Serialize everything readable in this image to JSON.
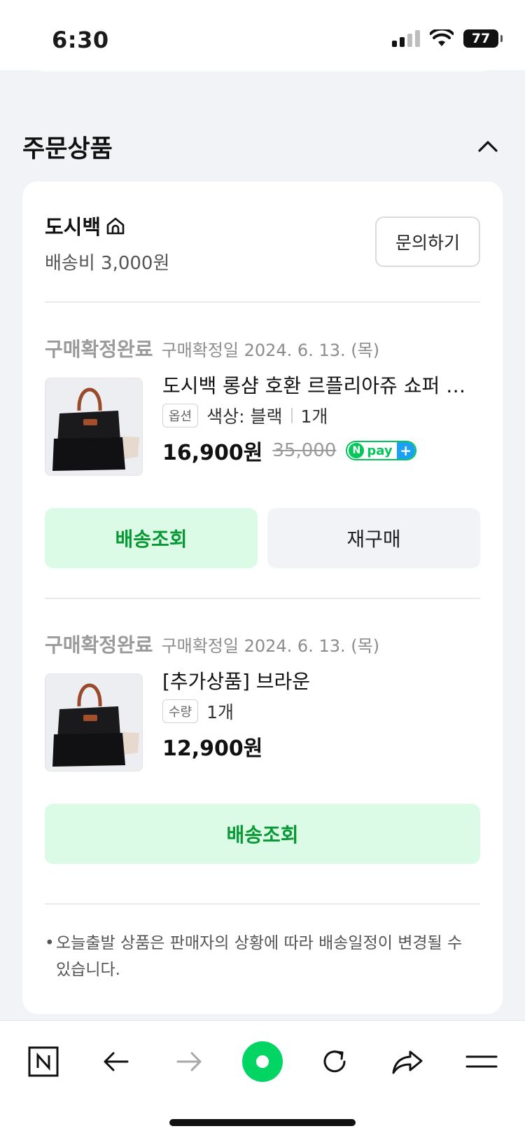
{
  "status_bar": {
    "time": "6:30",
    "battery": "77"
  },
  "section": {
    "title": "주문상품"
  },
  "seller": {
    "name": "도시백",
    "shipping_fee": "배송비 3,000원",
    "inquiry_label": "문의하기"
  },
  "orders": [
    {
      "status": "구매확정완료",
      "confirm_date": "구매확정일 2024. 6. 13. (목)",
      "item_name": "도시백 롱샴 호환 르플리아쥬 쇼퍼 백 블랙 세트",
      "option_tag": "옵션",
      "option_text": "색상: 블랙",
      "quantity": "1개",
      "price": "16,900원",
      "original_price": "35,000",
      "npay_label": "pay",
      "track_label": "배송조회",
      "rebuy_label": "재구매"
    },
    {
      "status": "구매확정완료",
      "confirm_date": "구매확정일 2024. 6. 13. (목)",
      "item_name": "[추가상품] 브라운",
      "option_tag": "수량",
      "quantity": "1개",
      "price": "12,900원",
      "track_label": "배송조회"
    }
  ],
  "notice": {
    "bullet": "•",
    "text": "오늘출발 상품은 판매자의 상황에 따라 배송일정이 변경될 수 있습니다."
  },
  "icons": {
    "collapse": "chevron-up-icon",
    "store": "store-home-icon",
    "nav": [
      "naver-n-icon",
      "arrow-left-icon",
      "arrow-right-icon",
      "green-dot-icon",
      "refresh-icon",
      "share-icon",
      "menu-icon"
    ]
  },
  "colors": {
    "accent_green": "#03c75a",
    "track_bg": "#dcfbe6",
    "track_text": "#079a34"
  }
}
